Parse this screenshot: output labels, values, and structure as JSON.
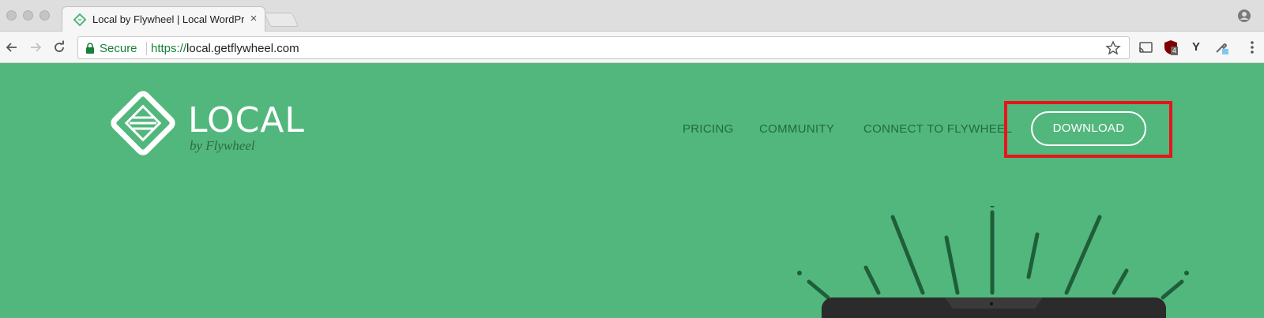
{
  "browser": {
    "tab": {
      "title": "Local by Flywheel | Local WordPress",
      "close_glyph": "×"
    },
    "omnibox": {
      "secure_label": "Secure",
      "url_scheme": "https://",
      "url_host": "local.getflywheel.com"
    },
    "extensions": [
      {
        "name": "cast-icon"
      },
      {
        "name": "ublock-icon",
        "badge": "4"
      },
      {
        "name": "y-extension-icon",
        "label": "Y"
      },
      {
        "name": "eyedropper-icon"
      }
    ]
  },
  "site": {
    "logo": {
      "word": "LOCAL",
      "sub": "by Flywheel"
    },
    "nav": {
      "pricing": "PRICING",
      "community": "COMMUNITY",
      "connect": "CONNECT TO FLYWHEEL",
      "download": "DOWNLOAD"
    },
    "colors": {
      "brand_green": "#52b77c",
      "dark_green": "#1f6b40",
      "highlight": "#e8141a"
    }
  }
}
